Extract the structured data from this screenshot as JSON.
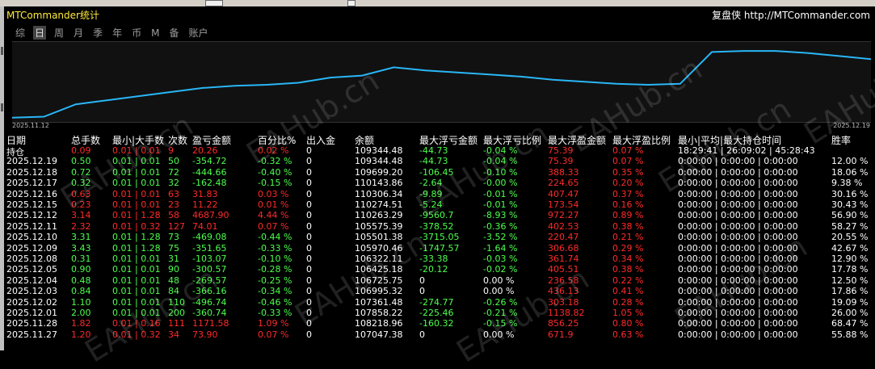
{
  "window": {
    "title": "MTCommander统计",
    "site_label": "复盘侠",
    "site_url": "http://MTCommander.com"
  },
  "tabs": [
    {
      "label": "综",
      "active": false
    },
    {
      "label": "日",
      "active": true
    },
    {
      "label": "周",
      "active": false
    },
    {
      "label": "月",
      "active": false
    },
    {
      "label": "季",
      "active": false
    },
    {
      "label": "年",
      "active": false
    },
    {
      "label": "币",
      "active": false
    },
    {
      "label": "M",
      "active": false
    },
    {
      "label": "备",
      "active": false
    },
    {
      "label": "账户",
      "active": false
    }
  ],
  "chart_data": {
    "type": "line",
    "x_start_label": "2025.11.12",
    "x_end_label": "2025.12.19",
    "series": [
      {
        "values": [
          1,
          2,
          14,
          18,
          22,
          26,
          30,
          32,
          33,
          35,
          40,
          42,
          50,
          47,
          45,
          43,
          41,
          38,
          36,
          34,
          33,
          34,
          65,
          66,
          66,
          64,
          61,
          58
        ]
      }
    ],
    "color": "#29b6f6"
  },
  "headers": {
    "date": "日期",
    "total_lots": "总手数",
    "minmax_lots": "最小|大手数",
    "count": "次数",
    "pnl": "盈亏金额",
    "pct": "百分比%",
    "deposit": "出入金",
    "balance": "余额",
    "max_float_loss": "最大浮亏金额",
    "max_float_loss_pct": "最大浮亏比例",
    "max_float_profit": "最大浮盈金额",
    "max_float_profit_pct": "最大浮盈比例",
    "hold_time": "最小|平均|最大持仓时间",
    "winrate": "胜率"
  },
  "rows": [
    {
      "date": "持仓",
      "lots": "0.09",
      "minmax": "0.01 | 0.01",
      "count": "9",
      "pnl": "20.26",
      "pct": "0.02 %",
      "deposit": "0",
      "balance": "109344.48",
      "fl": "-44.73",
      "flp": "-0.04 %",
      "fp": "75.39",
      "fpp": "0.07 %",
      "hold": "18:29:41 | 26:09:02 | 45:28:43",
      "win": "",
      "color": "red",
      "first": true
    },
    {
      "date": "2025.12.19",
      "lots": "0.50",
      "minmax": "0.01 | 0.01",
      "count": "50",
      "pnl": "-354.72",
      "pct": "-0.32 %",
      "deposit": "0",
      "balance": "109344.48",
      "fl": "-44.73",
      "flp": "-0.04 %",
      "fp": "75.39",
      "fpp": "0.07 %",
      "hold": "0:00:00 | 0:00:00 | 0:00:00",
      "win": "12.00 %",
      "color": "green"
    },
    {
      "date": "2025.12.18",
      "lots": "0.72",
      "minmax": "0.01 | 0.01",
      "count": "72",
      "pnl": "-444.66",
      "pct": "-0.40 %",
      "deposit": "0",
      "balance": "109699.20",
      "fl": "-106.45",
      "flp": "-0.10 %",
      "fp": "388.33",
      "fpp": "0.35 %",
      "hold": "0:00:00 | 0:00:00 | 0:00:00",
      "win": "18.06 %",
      "color": "green"
    },
    {
      "date": "2025.12.17",
      "lots": "0.32",
      "minmax": "0.01 | 0.01",
      "count": "32",
      "pnl": "-162.48",
      "pct": "-0.15 %",
      "deposit": "0",
      "balance": "110143.86",
      "fl": "-2.64",
      "flp": "-0.00 %",
      "fp": "224.65",
      "fpp": "0.20 %",
      "hold": "0:00:00 | 0:00:00 | 0:00:00",
      "win": "9.38 %",
      "color": "green"
    },
    {
      "date": "2025.12.16",
      "lots": "0.63",
      "minmax": "0.01 | 0.01",
      "count": "63",
      "pnl": "31.83",
      "pct": "0.03 %",
      "deposit": "0",
      "balance": "110306.34",
      "fl": "-9.89",
      "flp": "-0.01 %",
      "fp": "407.47",
      "fpp": "0.37 %",
      "hold": "0:00:00 | 0:00:00 | 0:00:00",
      "win": "30.16 %",
      "color": "red"
    },
    {
      "date": "2025.12.15",
      "lots": "0.23",
      "minmax": "0.01 | 0.01",
      "count": "23",
      "pnl": "11.22",
      "pct": "0.01 %",
      "deposit": "0",
      "balance": "110274.51",
      "fl": "-5.24",
      "flp": "-0.01 %",
      "fp": "173.54",
      "fpp": "0.16 %",
      "hold": "0:00:00 | 0:00:00 | 0:00:00",
      "win": "30.43 %",
      "color": "red"
    },
    {
      "date": "2025.12.12",
      "lots": "3.14",
      "minmax": "0.01 | 1.28",
      "count": "58",
      "pnl": "4687.90",
      "pct": "4.44 %",
      "deposit": "0",
      "balance": "110263.29",
      "fl": "-9560.7",
      "flp": "-8.93 %",
      "fp": "972.27",
      "fpp": "0.89 %",
      "hold": "0:00:00 | 0:00:00 | 0:00:00",
      "win": "56.90 %",
      "color": "red"
    },
    {
      "date": "2025.12.11",
      "lots": "2.32",
      "minmax": "0.01 | 0.32",
      "count": "127",
      "pnl": "74.01",
      "pct": "0.07 %",
      "deposit": "0",
      "balance": "105575.39",
      "fl": "-378.52",
      "flp": "-0.36 %",
      "fp": "402.53",
      "fpp": "0.38 %",
      "hold": "0:00:00 | 0:00:00 | 0:00:00",
      "win": "58.27 %",
      "color": "red"
    },
    {
      "date": "2025.12.10",
      "lots": "3.31",
      "minmax": "0.01 | 1.28",
      "count": "73",
      "pnl": "-469.08",
      "pct": "-0.44 %",
      "deposit": "0",
      "balance": "105501.38",
      "fl": "-3715.05",
      "flp": "-3.52 %",
      "fp": "220.47",
      "fpp": "0.21 %",
      "hold": "0:00:00 | 0:00:00 | 0:00:00",
      "win": "20.55 %",
      "color": "green"
    },
    {
      "date": "2025.12.09",
      "lots": "3.43",
      "minmax": "0.01 | 1.28",
      "count": "75",
      "pnl": "-351.65",
      "pct": "-0.33 %",
      "deposit": "0",
      "balance": "105970.46",
      "fl": "-1747.57",
      "flp": "-1.64 %",
      "fp": "306.68",
      "fpp": "0.29 %",
      "hold": "0:00:00 | 0:00:00 | 0:00:00",
      "win": "42.67 %",
      "color": "green"
    },
    {
      "date": "2025.12.08",
      "lots": "0.31",
      "minmax": "0.01 | 0.01",
      "count": "31",
      "pnl": "-103.07",
      "pct": "-0.10 %",
      "deposit": "0",
      "balance": "106322.11",
      "fl": "-33.38",
      "flp": "-0.03 %",
      "fp": "361.74",
      "fpp": "0.34 %",
      "hold": "0:00:00 | 0:00:00 | 0:00:00",
      "win": "12.90 %",
      "color": "green"
    },
    {
      "date": "2025.12.05",
      "lots": "0.90",
      "minmax": "0.01 | 0.01",
      "count": "90",
      "pnl": "-300.57",
      "pct": "-0.28 %",
      "deposit": "0",
      "balance": "106425.18",
      "fl": "-20.12",
      "flp": "-0.02 %",
      "fp": "405.51",
      "fpp": "0.38 %",
      "hold": "0:00:00 | 0:00:00 | 0:00:00",
      "win": "17.78 %",
      "color": "green"
    },
    {
      "date": "2025.12.04",
      "lots": "0.48",
      "minmax": "0.01 | 0.01",
      "count": "48",
      "pnl": "-269.57",
      "pct": "-0.25 %",
      "deposit": "0",
      "balance": "106725.75",
      "fl": "0",
      "flp": "0.00 %",
      "fp": "236.58",
      "fpp": "0.22 %",
      "hold": "0:00:00 | 0:00:00 | 0:00:00",
      "win": "12.50 %",
      "color": "green",
      "flwhite": true
    },
    {
      "date": "2025.12.03",
      "lots": "0.84",
      "minmax": "0.01 | 0.01",
      "count": "84",
      "pnl": "-366.16",
      "pct": "-0.34 %",
      "deposit": "0",
      "balance": "106995.32",
      "fl": "0",
      "flp": "0.00 %",
      "fp": "436.13",
      "fpp": "0.41 %",
      "hold": "0:00:00 | 0:00:00 | 0:00:00",
      "win": "17.86 %",
      "color": "green",
      "flwhite": true
    },
    {
      "date": "2025.12.02",
      "lots": "1.10",
      "minmax": "0.01 | 0.01",
      "count": "110",
      "pnl": "-496.74",
      "pct": "-0.46 %",
      "deposit": "0",
      "balance": "107361.48",
      "fl": "-274.77",
      "flp": "-0.26 %",
      "fp": "303.18",
      "fpp": "0.28 %",
      "hold": "0:00:00 | 0:00:00 | 0:00:00",
      "win": "19.09 %",
      "color": "green"
    },
    {
      "date": "2025.12.01",
      "lots": "2.00",
      "minmax": "0.01 | 0.01",
      "count": "200",
      "pnl": "-360.74",
      "pct": "-0.33 %",
      "deposit": "0",
      "balance": "107858.22",
      "fl": "-225.46",
      "flp": "-0.21 %",
      "fp": "1138.82",
      "fpp": "1.05 %",
      "hold": "0:00:00 | 0:00:00 | 0:00:00",
      "win": "26.00 %",
      "color": "green"
    },
    {
      "date": "2025.11.28",
      "lots": "1.82",
      "minmax": "0.01 | 0.16",
      "count": "111",
      "pnl": "1171.58",
      "pct": "1.09 %",
      "deposit": "0",
      "balance": "108218.96",
      "fl": "-160.32",
      "flp": "-0.15 %",
      "fp": "856.25",
      "fpp": "0.80 %",
      "hold": "0:00:00 | 0:00:00 | 0:00:00",
      "win": "68.47 %",
      "color": "red"
    },
    {
      "date": "2025.11.27",
      "lots": "1.20",
      "minmax": "0.01 | 0.32",
      "count": "34",
      "pnl": "73.90",
      "pct": "0.07 %",
      "deposit": "0",
      "balance": "107047.38",
      "fl": "0",
      "flp": "0.00 %",
      "fp": "671.9",
      "fpp": "0.63 %",
      "hold": "0:00:00 | 0:00:00 | 0:00:00",
      "win": "55.88 %",
      "color": "red",
      "flwhite": true
    }
  ],
  "watermark": "EAHub.cn"
}
